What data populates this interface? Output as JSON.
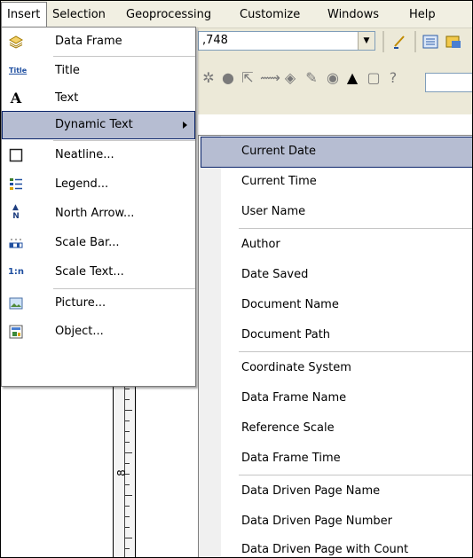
{
  "menubar": {
    "items": [
      {
        "label": "Insert"
      },
      {
        "label": "Selection"
      },
      {
        "label": "Geoprocessing"
      },
      {
        "label": "Customize"
      },
      {
        "label": "Windows"
      },
      {
        "label": "Help"
      }
    ]
  },
  "toolbar": {
    "scale_value": ",748"
  },
  "ruler": {
    "label": "8"
  },
  "insert_menu": {
    "items": [
      {
        "label": "Data Frame",
        "icon": "data-frame-icon"
      },
      {
        "label": "Title",
        "icon": "title-icon",
        "icon_text": "Title"
      },
      {
        "label": "Text",
        "icon": "text-icon",
        "icon_text": "A"
      },
      {
        "label": "Dynamic Text",
        "icon": "none",
        "highlighted": true,
        "has_submenu": true
      },
      {
        "label": "Neatline...",
        "icon": "neatline-icon"
      },
      {
        "label": "Legend...",
        "icon": "legend-icon"
      },
      {
        "label": "North Arrow...",
        "icon": "north-arrow-icon",
        "icon_text": "N"
      },
      {
        "label": "Scale Bar...",
        "icon": "scale-bar-icon"
      },
      {
        "label": "Scale Text...",
        "icon": "scale-text-icon",
        "icon_text": "1:n"
      },
      {
        "label": "Picture...",
        "icon": "picture-icon"
      },
      {
        "label": "Object...",
        "icon": "object-icon"
      }
    ]
  },
  "dynamic_text_menu": {
    "items": [
      {
        "label": "Current Date",
        "highlighted": true
      },
      {
        "label": "Current Time"
      },
      {
        "label": "User Name"
      },
      {
        "label": "Author"
      },
      {
        "label": "Date Saved"
      },
      {
        "label": "Document Name"
      },
      {
        "label": "Document Path"
      },
      {
        "label": "Coordinate System"
      },
      {
        "label": "Data Frame Name"
      },
      {
        "label": "Reference Scale"
      },
      {
        "label": "Data Frame Time"
      },
      {
        "label": "Data Driven Page Name"
      },
      {
        "label": "Data Driven Page Number"
      },
      {
        "label": "Data Driven Page with Count"
      }
    ]
  },
  "colors": {
    "highlight": "#b6bdd2",
    "highlight_border": "#0a246a",
    "menubar_bg": "#f1efe2",
    "toolbar_bg": "#ece9d8"
  }
}
